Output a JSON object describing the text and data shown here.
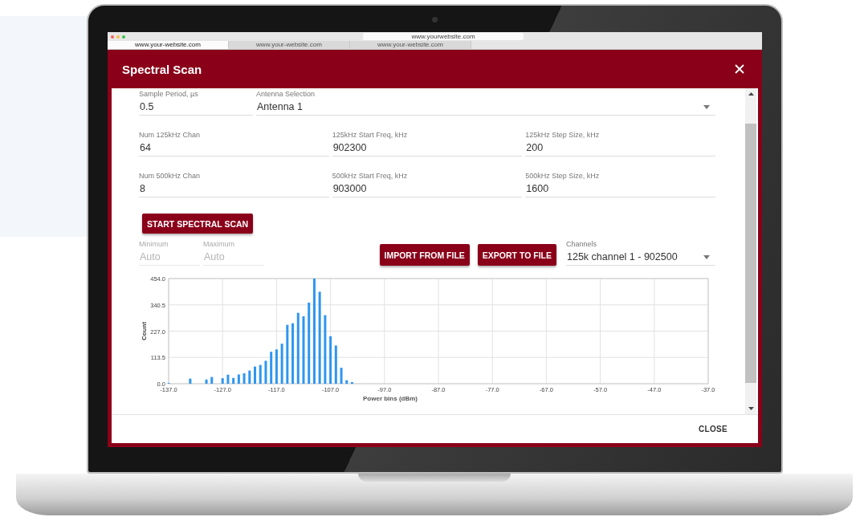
{
  "browser": {
    "url": "www.yourwebsite.com",
    "tabs": [
      {
        "label": "www.your-website.com",
        "selected": true
      },
      {
        "label": "www.your-website.com",
        "selected": false
      },
      {
        "label": "www.your-website.com",
        "selected": false
      }
    ]
  },
  "dialog": {
    "title": "Spectral Scan",
    "settings_rows": [
      [
        {
          "label": "Sample Period, µs",
          "value": "0.5",
          "kind": "input"
        },
        {
          "label": "Antenna Selection",
          "value": "Antenna 1",
          "kind": "select"
        }
      ],
      [
        {
          "label": "Num 125kHz Chan",
          "value": "64",
          "kind": "input"
        },
        {
          "label": "125kHz Start Freq, kHz",
          "value": "902300",
          "kind": "input"
        },
        {
          "label": "125kHz Step Size, kHz",
          "value": "200",
          "kind": "input"
        }
      ],
      [
        {
          "label": "Num 500kHz Chan",
          "value": "8",
          "kind": "input"
        },
        {
          "label": "500kHz Start Freq, kHz",
          "value": "903000",
          "kind": "input"
        },
        {
          "label": "500kHz Step Size, kHz",
          "value": "1600",
          "kind": "input"
        }
      ]
    ],
    "start_button": "START SPECTRAL SCAN",
    "range_fields": [
      {
        "label": "Minimum",
        "placeholder": "Auto",
        "disabled": true
      },
      {
        "label": "Maximum",
        "placeholder": "Auto",
        "disabled": true
      }
    ],
    "file_buttons": [
      "IMPORT FROM FILE",
      "EXPORT TO FILE"
    ],
    "channels": {
      "label": "Channels",
      "value": "125k channel 1 - 902500"
    },
    "chart_data": {
      "type": "bar",
      "grid": true,
      "xlabel": "Power bins (dBm)",
      "ylabel": "Count",
      "x": [
        -137,
        -133,
        -130,
        -129,
        -127,
        -126,
        -125,
        -124,
        -123,
        -122,
        -121,
        -120,
        -119,
        -118,
        -117,
        -116,
        -115,
        -114,
        -113,
        -112,
        -111,
        -110,
        -109,
        -108,
        -107,
        -106,
        -105,
        -104,
        -103
      ],
      "values": [
        3,
        22,
        18,
        29,
        24,
        39,
        25,
        40,
        45,
        57,
        74,
        81,
        99,
        138,
        148,
        173,
        254,
        261,
        306,
        291,
        350,
        454,
        397,
        296,
        205,
        165,
        69,
        15,
        7
      ],
      "xlim": [
        -137,
        -37
      ],
      "ylim": [
        0,
        454
      ],
      "xticks": [
        {
          "value": -137,
          "label": "-137.0"
        },
        {
          "value": -127,
          "label": "-127.0"
        },
        {
          "value": -117,
          "label": "-117.0"
        },
        {
          "value": -107,
          "label": "-107.0"
        },
        {
          "value": -97,
          "label": "-97.0"
        },
        {
          "value": -87,
          "label": "-87.0"
        },
        {
          "value": -77,
          "label": "-77.0"
        },
        {
          "value": -67,
          "label": "-67.0"
        },
        {
          "value": -57,
          "label": "-57.0"
        },
        {
          "value": -47,
          "label": "-47.0"
        },
        {
          "value": -37,
          "label": "-37.0"
        }
      ],
      "yticks": [
        {
          "value": 0,
          "label": "0.0"
        },
        {
          "value": 113.5,
          "label": "113.5"
        },
        {
          "value": 227,
          "label": "227.0"
        },
        {
          "value": 340.5,
          "label": "340.5"
        },
        {
          "value": 454,
          "label": "454.0"
        }
      ]
    },
    "footer_button": "CLOSE"
  }
}
